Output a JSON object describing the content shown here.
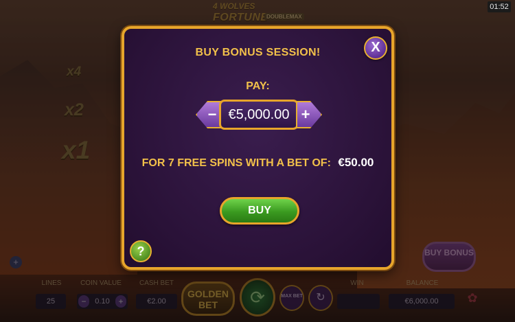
{
  "clock": "01:52",
  "logo": {
    "line1": "4 WOLVES",
    "line2": "FORTUNE",
    "badge": "DOUBLEMAX"
  },
  "multipliers": [
    "x4",
    "x2",
    "x1"
  ],
  "modal": {
    "title": "BUY BONUS SESSION!",
    "close_label": "X",
    "pay_label": "PAY:",
    "price": "€5,000.00",
    "minus_label": "−",
    "plus_label": "+",
    "offer_text": "FOR 7 FREE SPINS WITH A BET OF:",
    "offer_value": "€50.00",
    "buy_label": "BUY",
    "help_label": "?"
  },
  "bottom_bar": {
    "lines_label": "LINES",
    "lines_value": "25",
    "coin_value_label": "COIN VALUE",
    "coin_value": "0.10",
    "cash_bet_label": "CASH BET",
    "cash_bet": "€2.00",
    "golden_bet_label": "GOLDEN BET",
    "win_label": "WIN",
    "win_value": "",
    "balance_label": "BALANCE",
    "balance_value": "€6,000.00",
    "max_bet_label": "MAX BET",
    "buy_bonus_label": "BUY BONUS"
  },
  "colors": {
    "accent_gold": "#f2c14a",
    "modal_bg": "#2a1238",
    "buy_green": "#3a9a20",
    "border_gold": "#e7a52b"
  }
}
